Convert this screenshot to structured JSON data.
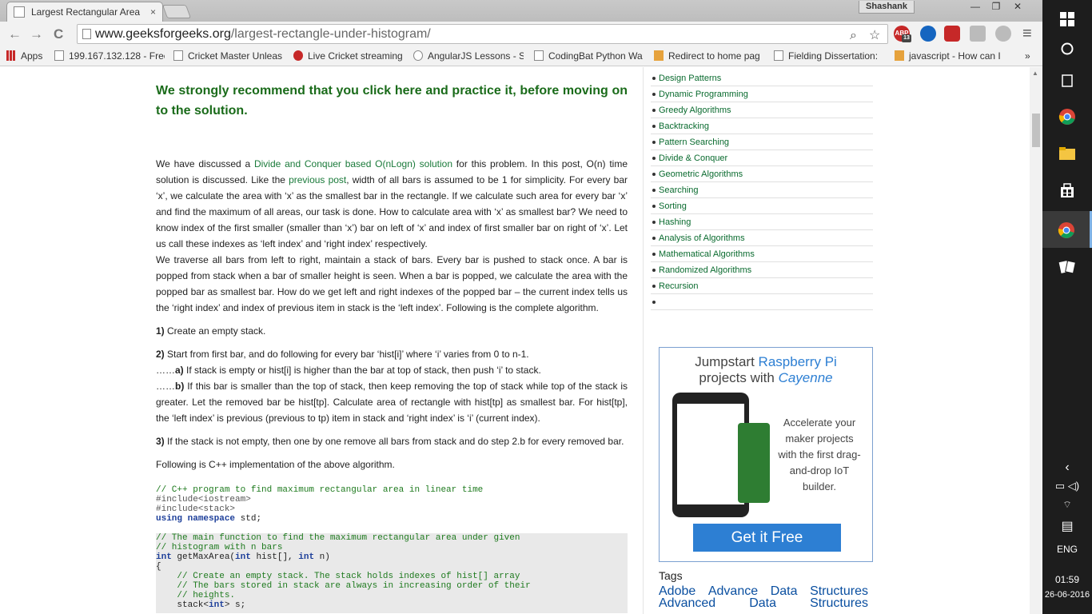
{
  "tab": {
    "title": "Largest Rectangular Area",
    "close": "×"
  },
  "profile": "Shashank",
  "window": {
    "minimize": "—",
    "maximize": "❐",
    "close": "✕"
  },
  "toolbar": {
    "back": "←",
    "forward": "→",
    "reload": "C",
    "url_domain": "www.geeksforgeeks.org",
    "url_path": "/largest-rectangle-under-histogram/",
    "search_icon": "⌕",
    "star_icon": "☆",
    "abp_label": "ABP",
    "abp_count": "13",
    "menu": "≡"
  },
  "bookmarks": [
    "Apps",
    "199.167.132.128 - Free",
    "Cricket Master Unleas",
    "Live Cricket streaming",
    "AngularJS Lessons - S",
    "CodingBat Python Wa",
    "Redirect to home pag",
    "Fielding Dissertation:",
    "javascript - How can I"
  ],
  "bookmarks_more": "»",
  "article": {
    "recommend": "We strongly recommend that you click here and practice it, before moving on to the solution.",
    "p1_a": "We have discussed a ",
    "p1_link1": "Divide and Conquer based O(nLogn) solution",
    "p1_b": " for this problem. In this post, O(n) time solution is discussed. Like the ",
    "p1_link2": "previous post",
    "p1_c": ", width of all bars is assumed to be 1 for simplicity. For every bar ‘x’, we calculate the area with ‘x’ as the smallest bar in the rectangle. If we calculate such area for every bar ‘x’ and find the maximum of all areas, our task is done. How to calculate area with ‘x’ as smallest bar? We need to know index of the first smaller (smaller than ‘x’) bar on left of ‘x’ and index of first smaller bar on right of ‘x’. Let us call these indexes as ‘left index’ and ‘right index’ respectively.",
    "p2": "We traverse all bars from left to right, maintain a stack of bars. Every bar is pushed to stack once. A bar is popped from stack when a bar of smaller height is seen. When a bar is popped, we calculate the area with the popped bar as smallest bar. How do we get left and right indexes of the popped bar – the current index tells us the ‘right index’ and index of previous item in stack is the ‘left index’. Following is the complete algorithm.",
    "s1_num": "1)",
    "s1": " Create an empty stack.",
    "s2_num": "2)",
    "s2": " Start from first bar, and do following for every bar ‘hist[i]’ where ‘i’ varies from 0 to n-1.",
    "s2a_dots": "……",
    "s2a_lbl": "a)",
    "s2a": " If stack is empty or hist[i] is higher than the bar at top of stack, then push ‘i’ to stack.",
    "s2b_dots": "……",
    "s2b_lbl": "b)",
    "s2b": " If this bar is smaller than the top of stack, then keep removing the top of stack while top of the stack is greater. Let the removed bar be hist[tp]. Calculate area of rectangle with hist[tp] as smallest bar. For hist[tp], the ‘left index’ is previous (previous to tp) item in stack and ‘right index’ is ‘i’ (current index).",
    "s3_num": "3)",
    "s3": " If the stack is not empty, then one by one remove all bars from stack and do step 2.b for every removed bar.",
    "following": "Following is C++ implementation of the above algorithm."
  },
  "code": {
    "c1": "// C++ program to find maximum rectangular area in linear time",
    "inc1": "#include<iostream>",
    "inc2": "#include<stack>",
    "using_kw1": "using",
    "using_kw2": "namespace",
    "using_rest": " std;",
    "m1": "// The main function to find the maximum rectangular area under given",
    "m2": "// histogram with n bars",
    "sig_t1": "int",
    "sig_a": " getMaxArea(",
    "sig_t2": "int",
    "sig_b": " hist[], ",
    "sig_t3": "int",
    "sig_c": " n)",
    "brace": "{",
    "b1": "    // Create an empty stack. The stack holds indexes of hist[] array",
    "b2": "    // The bars stored in stack are always in increasing order of their",
    "b3": "    // heights.",
    "st_a": "    stack<",
    "st_t": "int",
    "st_b": "> s;"
  },
  "sidebar": {
    "categories": [
      "Design Patterns",
      "Dynamic Programming",
      "Greedy Algorithms",
      "Backtracking",
      "Pattern Searching",
      "Divide & Conquer",
      "Geometric Algorithms",
      "Searching",
      "Sorting",
      "Hashing",
      "Analysis of Algorithms",
      "Mathematical Algorithms",
      "Randomized Algorithms",
      "Recursion"
    ],
    "ad": {
      "h1_a": "Jumpstart ",
      "h1_b": "Raspberry Pi",
      "h2_a": "projects with ",
      "h2_b": "Cayenne",
      "body": "Accelerate your maker projects with the first drag-and-drop IoT builder.",
      "cta": "Get it Free"
    },
    "tags_title": "Tags",
    "tags_line1": [
      "Adobe",
      "Advance",
      "Data",
      "Structures"
    ],
    "tags_line2": [
      "Advanced",
      "Data",
      "Structures"
    ]
  },
  "taskbar": {
    "lang": "ENG",
    "time": "01:59",
    "date": "26-06-2016"
  }
}
